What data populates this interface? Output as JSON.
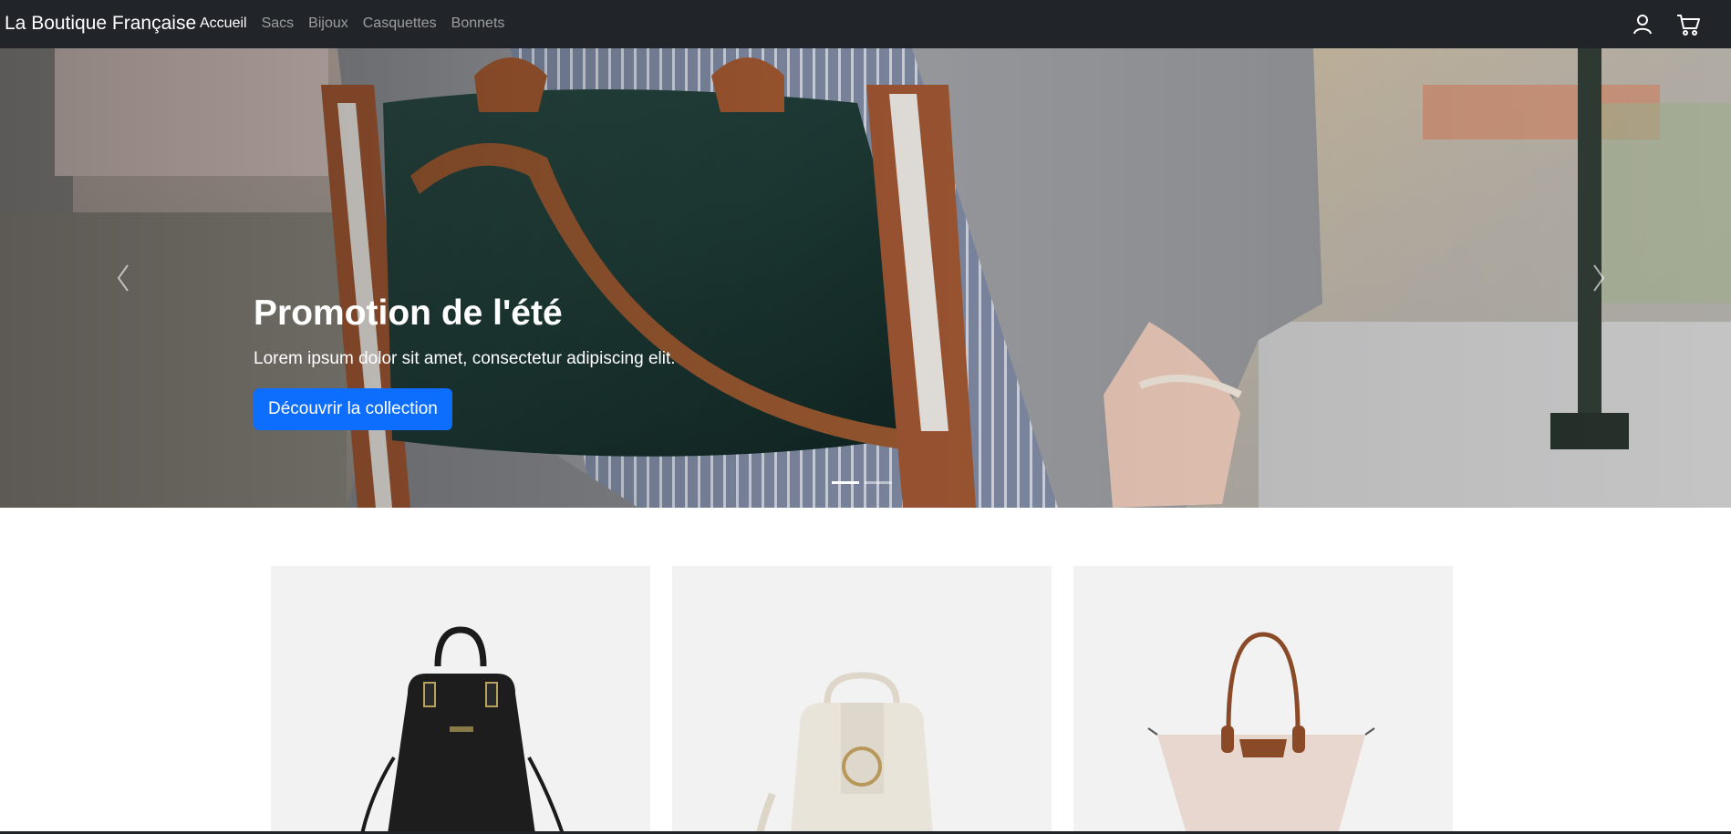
{
  "navbar": {
    "brand": "La Boutique Française",
    "links": [
      {
        "label": "Accueil",
        "active": true
      },
      {
        "label": "Sacs",
        "active": false
      },
      {
        "label": "Bijoux",
        "active": false
      },
      {
        "label": "Casquettes",
        "active": false
      },
      {
        "label": "Bonnets",
        "active": false
      }
    ],
    "icons": [
      "user-icon",
      "cart-icon"
    ]
  },
  "hero": {
    "title": "Promotion de l'été",
    "subtitle": "Lorem ipsum dolor sit amet, consectetur adipiscing elit.",
    "button_label": "Découvrir la collection",
    "slide_count": 2,
    "active_slide": 1,
    "controls": [
      "chevron-left-icon",
      "chevron-right-icon"
    ]
  },
  "products": [
    {
      "image": "black-handbag"
    },
    {
      "image": "cream-backpack"
    },
    {
      "image": "beige-tote"
    }
  ],
  "colors": {
    "navbar_bg": "#212529",
    "primary": "#0d6efd",
    "card_bg": "#f2f2f2"
  }
}
